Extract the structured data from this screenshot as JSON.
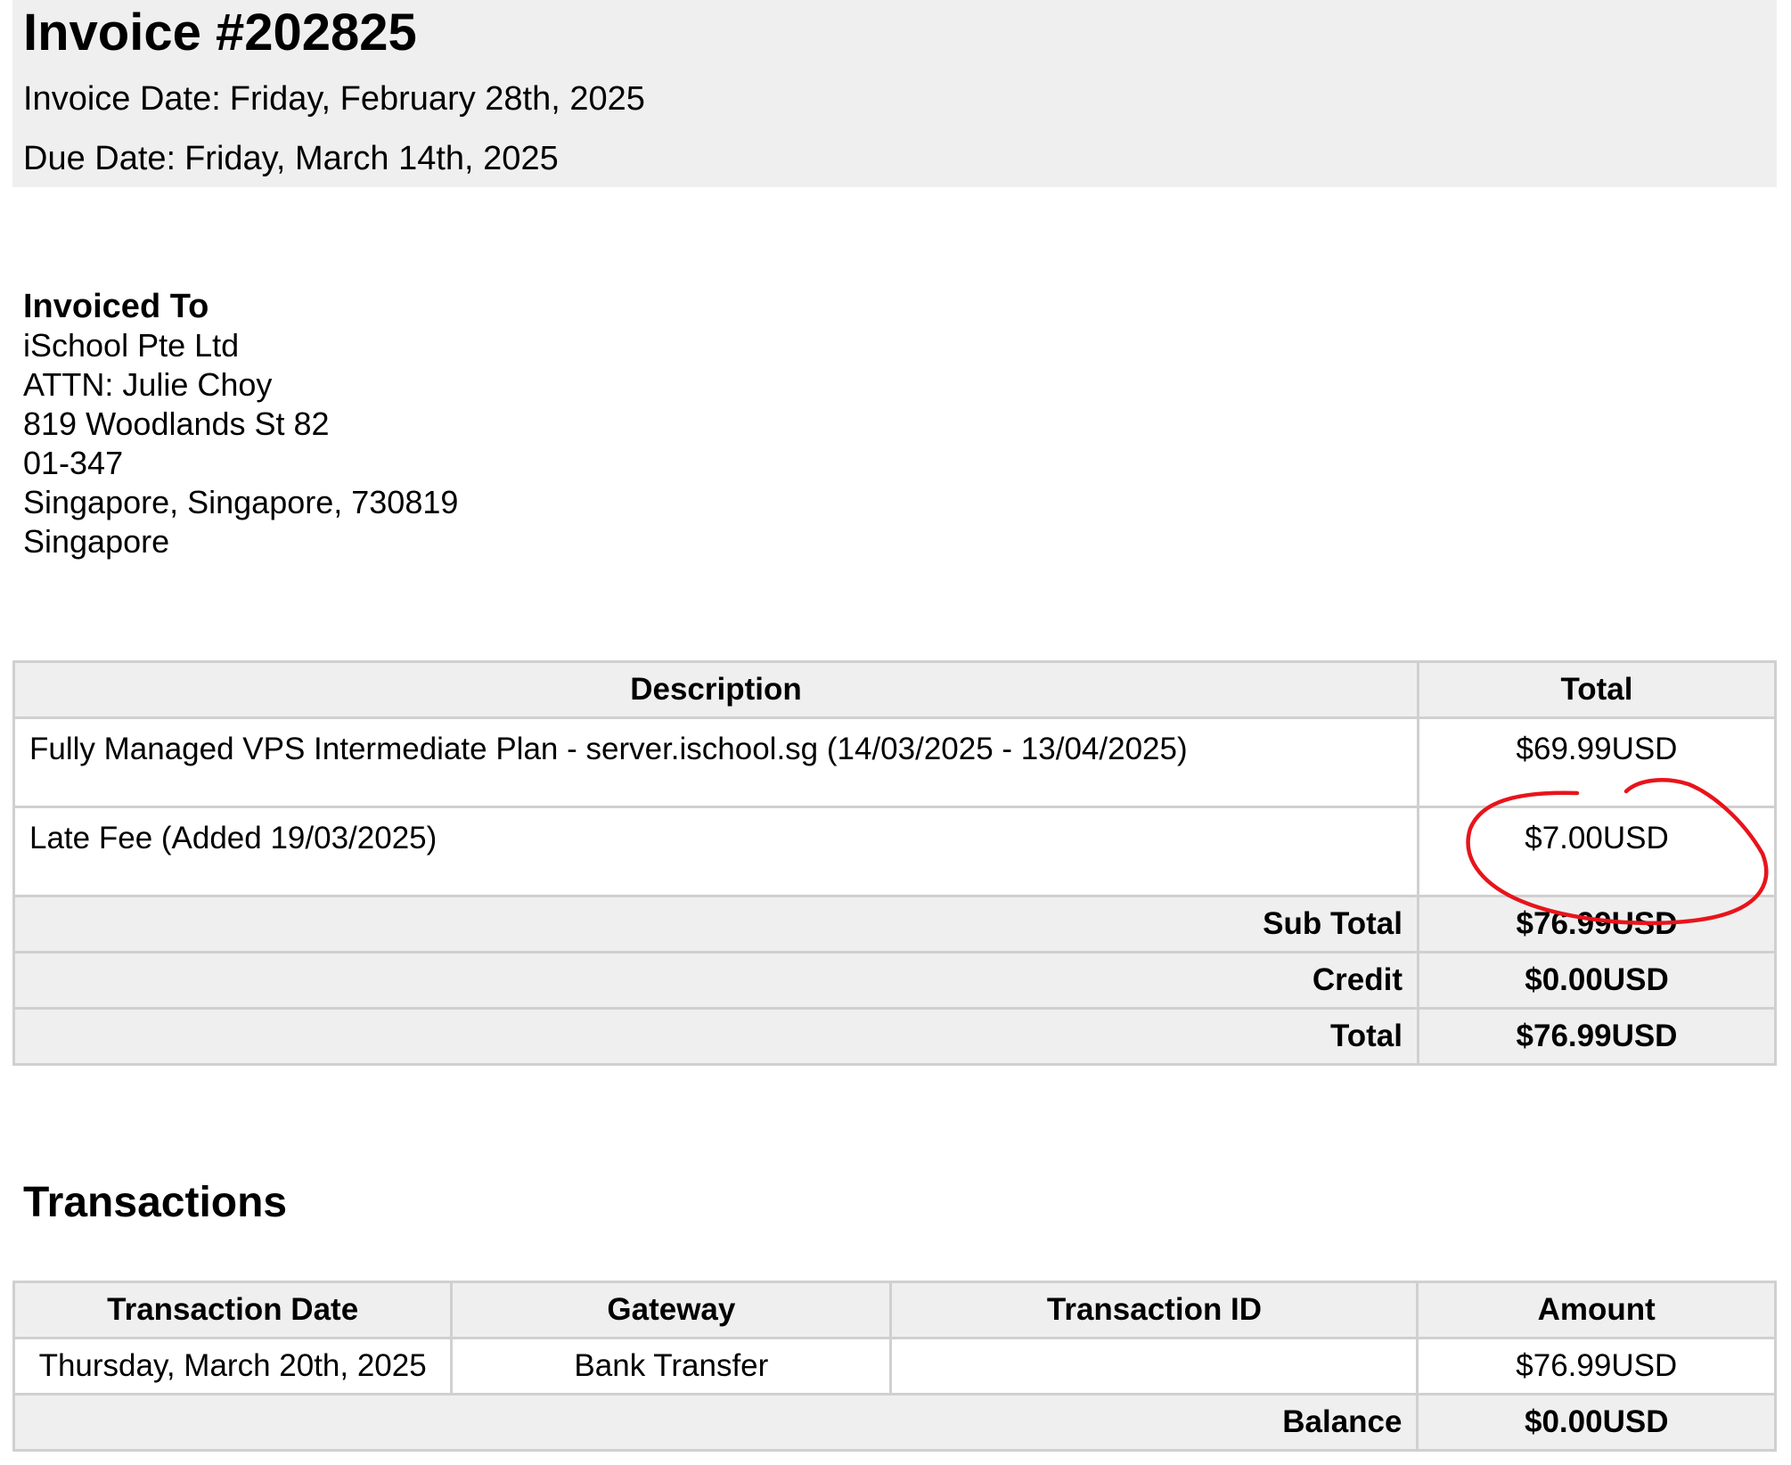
{
  "invoice": {
    "title": "Invoice #202825",
    "invoice_date_label": "Invoice Date:",
    "invoice_date": "Friday, February 28th, 2025",
    "due_date_label": "Due Date:",
    "due_date": "Friday, March 14th, 2025"
  },
  "billed_to": {
    "heading": "Invoiced To",
    "lines": [
      "iSchool Pte Ltd",
      "ATTN: Julie Choy",
      "819 Woodlands St 82",
      "01-347",
      "Singapore, Singapore, 730819",
      "Singapore"
    ]
  },
  "items": {
    "headers": {
      "description": "Description",
      "total": "Total"
    },
    "rows": [
      {
        "description": "Fully Managed VPS Intermediate Plan - server.ischool.sg (14/03/2025 - 13/04/2025)",
        "total": "$69.99USD"
      },
      {
        "description": "Late Fee (Added 19/03/2025)",
        "total": "$7.00USD"
      }
    ],
    "summary": [
      {
        "label": "Sub Total",
        "value": "$76.99USD"
      },
      {
        "label": "Credit",
        "value": "$0.00USD"
      },
      {
        "label": "Total",
        "value": "$76.99USD"
      }
    ]
  },
  "annotation": {
    "color": "#e8141b",
    "circled_item": "$7.00USD"
  },
  "transactions": {
    "heading": "Transactions",
    "headers": {
      "date": "Transaction Date",
      "gateway": "Gateway",
      "id": "Transaction ID",
      "amount": "Amount"
    },
    "rows": [
      {
        "date": "Thursday, March 20th, 2025",
        "gateway": "Bank Transfer",
        "id": "",
        "amount": "$76.99USD"
      }
    ],
    "balance_label": "Balance",
    "balance_value": "$0.00USD"
  }
}
